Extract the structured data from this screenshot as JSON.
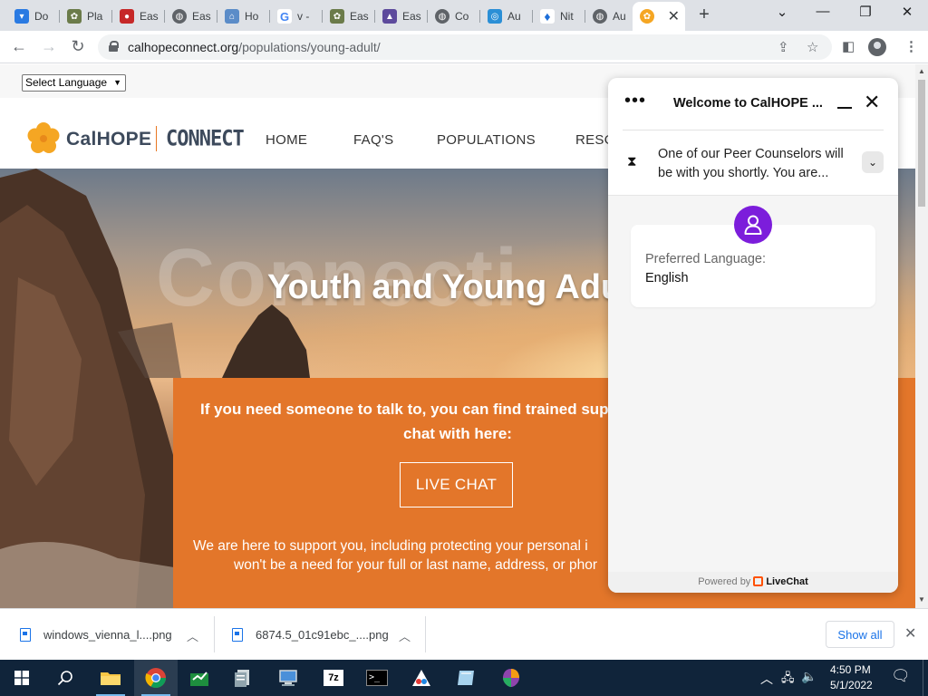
{
  "browser": {
    "tabs": [
      {
        "label": "Do",
        "color": "#2a7ae2"
      },
      {
        "label": "Pla",
        "color": "#6b7b4a"
      },
      {
        "label": "Eas",
        "color": "#c62828"
      },
      {
        "label": "Eas",
        "color": "#5f6368"
      },
      {
        "label": "Ho",
        "color": "#5b8cc8"
      },
      {
        "label": "v -",
        "color": "#4285f4"
      },
      {
        "label": "Eas",
        "color": "#6b7b4a"
      },
      {
        "label": "Eas",
        "color": "#5d4a9c"
      },
      {
        "label": "Co",
        "color": "#5f6368"
      },
      {
        "label": "Au",
        "color": "#2b8fd6"
      },
      {
        "label": "Nit",
        "color": "#1e6fd9"
      },
      {
        "label": "Au",
        "color": "#5f6368"
      }
    ],
    "active_tab_color": "#f5a623",
    "url_host": "calhopeconnect.org",
    "url_path": "/populations/young-adult/"
  },
  "page": {
    "language_select": "Select Language",
    "logo_cal": "CalHOPE",
    "logo_connect": "CONNECT",
    "nav": [
      "HOME",
      "FAQ'S",
      "POPULATIONS",
      "RESO"
    ],
    "watermark": "Connecti",
    "hero_title": "Youth and Young Adu",
    "intro_line1": "If you need someone to talk to, you can find trained supp",
    "intro_line2": "chat with here:",
    "live_chat_button": "LIVE CHAT",
    "support_line1": "We are here to support you, including protecting your personal i",
    "support_line2": "won't be a need for your full or last name, address, or phor",
    "brand_orange": "#e3762a"
  },
  "chat": {
    "title": "Welcome to CalHOPE ...",
    "status": "One of our Peer Counselors will be with you shortly. You are...",
    "card_label": "Preferred Language:",
    "card_value": "English",
    "footer_powered": "Powered by",
    "footer_brand": "LiveChat",
    "accent": "#7c1ddb"
  },
  "downloads": {
    "items": [
      "windows_vienna_l....png",
      "6874.5_01c91ebc_....png"
    ],
    "show_all": "Show all"
  },
  "taskbar": {
    "time": "4:50 PM",
    "date": "5/1/2022"
  }
}
